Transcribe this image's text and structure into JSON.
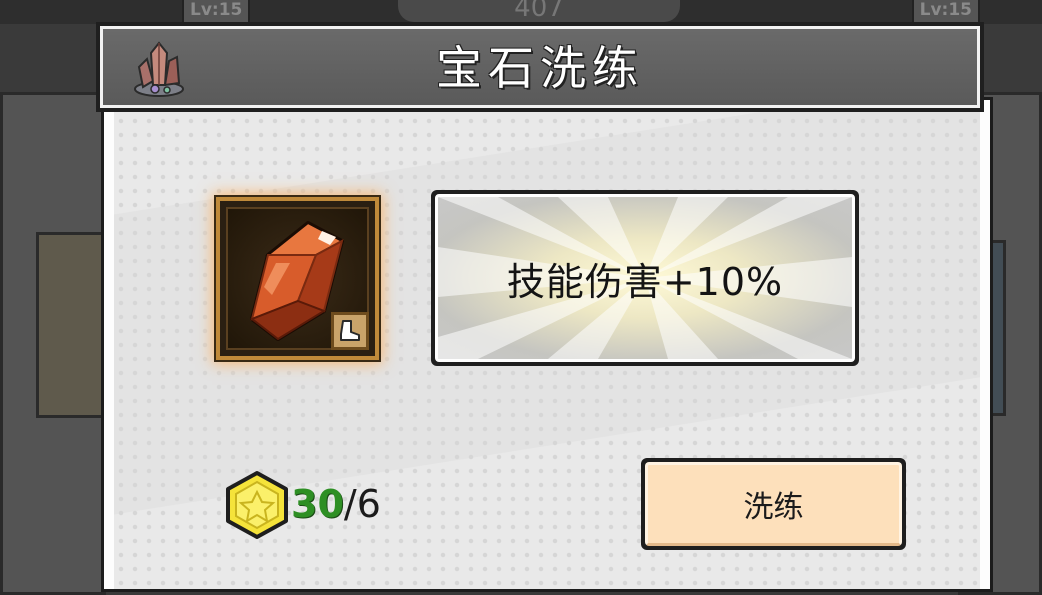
{
  "background": {
    "left_level": "Lv:15",
    "right_level": "Lv:15",
    "top_score": "407"
  },
  "dialog": {
    "title": "宝石洗练",
    "title_icon": "crystal-cluster-icon",
    "gem": {
      "icon": "orange-gem-icon",
      "slot_badge_icon": "boot-icon"
    },
    "stat_text": "技能伤害+10%",
    "cost": {
      "icon": "yellow-gem-coin-icon",
      "have": "30",
      "separator_required": "/6"
    },
    "refine_button_label": "洗练"
  },
  "colors": {
    "title_bar": "#5f5f5f",
    "dialog_bg": "#e9e9e9",
    "gem_slot_border": "#c08a3a",
    "gem_glow": "#ffaa50",
    "cost_have": "#2e8f24",
    "button_bg": "#fde0bb"
  }
}
